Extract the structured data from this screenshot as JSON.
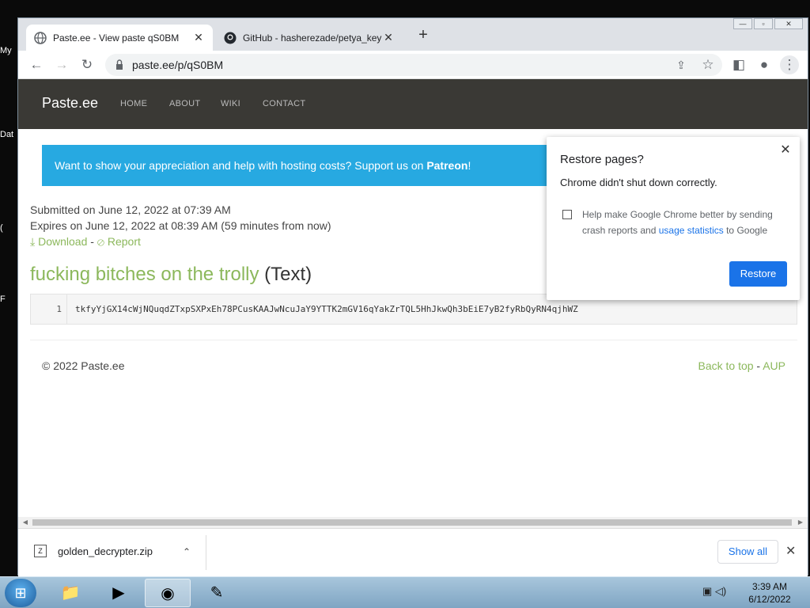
{
  "desktop": {
    "icon_labels": [
      "My",
      "Dat",
      "(",
      "F"
    ]
  },
  "window": {
    "minimize": "—",
    "maximize": "▫",
    "close": "✕"
  },
  "tabs": [
    {
      "title": "Paste.ee - View paste qS0BM",
      "icon": "globe-icon",
      "close": "✕"
    },
    {
      "title": "GitHub - hasherezade/petya_key",
      "icon": "github-icon",
      "close": "✕"
    }
  ],
  "toolbar": {
    "back": "←",
    "forward": "→",
    "reload": "↻",
    "url": "paste.ee/p/qS0BM",
    "share": "⇪",
    "star": "☆",
    "sidepanel": "◧",
    "profile": "●",
    "menu": "⋮",
    "newtab": "+"
  },
  "site": {
    "brand": "Paste.ee",
    "nav": [
      "HOME",
      "ABOUT",
      "WIKI",
      "CONTACT"
    ],
    "patreon_text": "Want to show your appreciation and help with hosting costs? Support us on ",
    "patreon_link": "Patreon",
    "patreon_suffix": "!",
    "submitted": "Submitted on June 12, 2022 at 07:39 AM",
    "expires": "Expires on June 12, 2022 at 08:39 AM (59 minutes from now)",
    "download": "Download",
    "separator": " - ",
    "report": "Report",
    "paste_title": "fucking bitches on the trolly",
    "paste_type": "(Text)",
    "line_number": "1",
    "code_line": "tkfyYjGX14cWjNQuqdZTxpSXPxEh78PCusKAAJwNcuJaY9YTTK2mGV16qYakZrTQL5HhJkwQh3bEiE7yB2fyRbQyRN4qjhWZ",
    "copyright": "© 2022 Paste.ee",
    "back_to_top": "Back to top",
    "foot_sep": " - ",
    "aup": "AUP"
  },
  "restore_dialog": {
    "title": "Restore pages?",
    "subtitle": "Chrome didn't shut down correctly.",
    "checkbox_text_1": "Help make Google Chrome better by sending crash reports and ",
    "checkbox_link": "usage statistics",
    "checkbox_text_2": " to Google",
    "button": "Restore",
    "close": "✕",
    "checked": false
  },
  "downloads": {
    "file": "golden_decrypter.zip",
    "show_all": "Show all",
    "close": "✕",
    "chevron": "⌃"
  },
  "taskbar": {
    "time": "3:39 AM",
    "date": "6/12/2022"
  },
  "colors": {
    "accent_green": "#8cb85c",
    "patreon_blue": "#27a9e1",
    "nav_dark": "#3a3935",
    "chrome_blue": "#1a73e8"
  }
}
